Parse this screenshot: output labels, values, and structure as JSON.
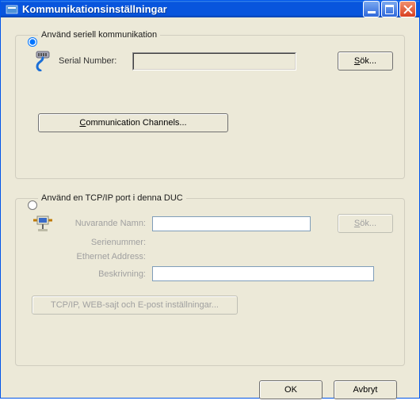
{
  "window": {
    "title": "Kommunikationsinställningar"
  },
  "serial_group": {
    "legend": "Använd seriell kommunikation",
    "serial_number_label": "Serial Number:",
    "serial_number_value": "",
    "search_button": "Sök...",
    "channels_button": "Communication Channels..."
  },
  "tcp_group": {
    "legend": "Använd en TCP/IP port i denna DUC",
    "name_label": "Nuvarande Namn:",
    "name_value": "",
    "serial_label": "Serienummer:",
    "serial_value": "",
    "ethernet_label": "Ethernet Address:",
    "ethernet_value": "",
    "description_label": "Beskrivning:",
    "description_value": "",
    "search_button": "Sök...",
    "settings_button": "TCP/IP, WEB-sajt och E-post inställningar..."
  },
  "buttons": {
    "ok": "OK",
    "cancel": "Avbryt"
  },
  "selected_mode": "serial"
}
